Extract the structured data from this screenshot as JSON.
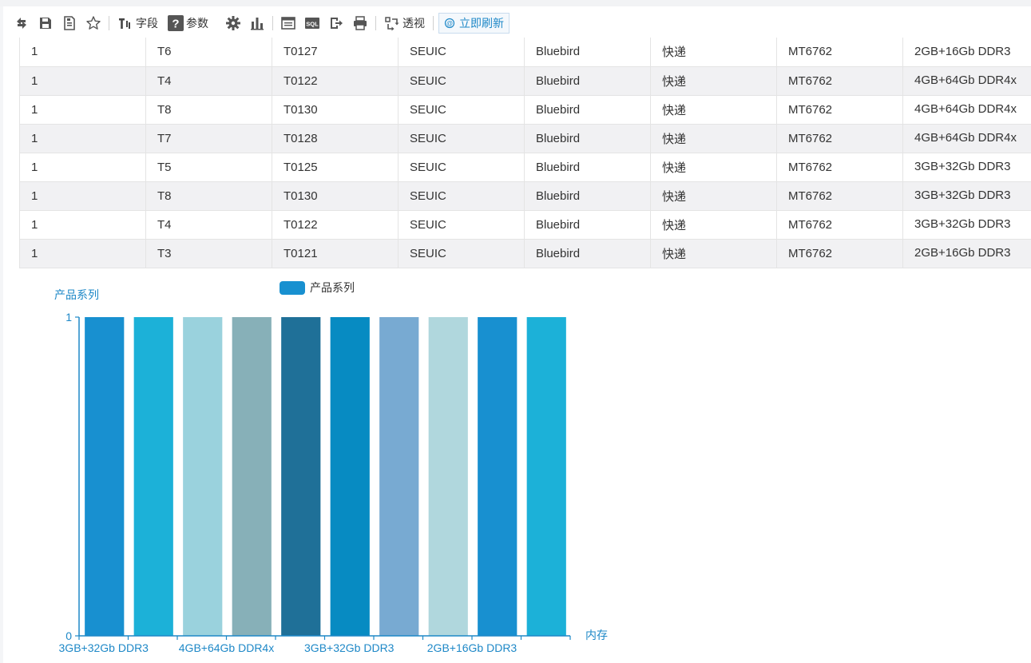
{
  "toolbar": {
    "icons": [
      "refresh-icon",
      "save-icon",
      "save-as-icon",
      "favorite-icon"
    ],
    "field_label": "字段",
    "param_label": "参数",
    "icons2": [
      "settings-icon",
      "bar-chart-icon",
      "table-icon",
      "sql-icon",
      "export-icon",
      "print-icon"
    ],
    "pivot_label": "透视",
    "refresh_now_label": "立即刷新"
  },
  "table": {
    "rows": [
      [
        "1",
        "T6",
        "T0127",
        "SEUIC",
        "Bluebird",
        "快递",
        "MT6762",
        "2GB+16Gb  DDR3"
      ],
      [
        "1",
        "T4",
        "T0122",
        "SEUIC",
        "Bluebird",
        "快递",
        "MT6762",
        "4GB+64Gb  DDR4x"
      ],
      [
        "1",
        "T8",
        "T0130",
        "SEUIC",
        "Bluebird",
        "快递",
        "MT6762",
        "4GB+64Gb  DDR4x"
      ],
      [
        "1",
        "T7",
        "T0128",
        "SEUIC",
        "Bluebird",
        "快递",
        "MT6762",
        "4GB+64Gb  DDR4x"
      ],
      [
        "1",
        "T5",
        "T0125",
        "SEUIC",
        "Bluebird",
        "快递",
        "MT6762",
        "3GB+32Gb  DDR3"
      ],
      [
        "1",
        "T8",
        "T0130",
        "SEUIC",
        "Bluebird",
        "快递",
        "MT6762",
        "3GB+32Gb  DDR3"
      ],
      [
        "1",
        "T4",
        "T0122",
        "SEUIC",
        "Bluebird",
        "快递",
        "MT6762",
        "3GB+32Gb  DDR3"
      ],
      [
        "1",
        "T3",
        "T0121",
        "SEUIC",
        "Bluebird",
        "快递",
        "MT6762",
        "2GB+16Gb  DDR3"
      ]
    ]
  },
  "chart_data": {
    "type": "bar",
    "title": "",
    "legend": [
      "产品系列"
    ],
    "legend_position": "top-center",
    "ylabel": "产品系列",
    "xlabel": "内存",
    "ylim": [
      0,
      1
    ],
    "yticks": [
      "0",
      "1"
    ],
    "x_tick_labels": [
      "3GB+32Gb DDR3",
      "4GB+64Gb DDR4x",
      "3GB+32Gb DDR3",
      "2GB+16Gb DDR3"
    ],
    "series": [
      {
        "name": "产品系列",
        "values": [
          1,
          1,
          1,
          1,
          1,
          1,
          1,
          1,
          1,
          1
        ]
      }
    ],
    "bar_colors": [
      "#1890d0",
      "#1cb1d8",
      "#9ad2dd",
      "#87b0b8",
      "#1f7098",
      "#078bc2",
      "#78aad2",
      "#b0d7dd",
      "#1890d0",
      "#1cb1d8"
    ],
    "axis_color": "#1e88c7",
    "grid": false
  }
}
